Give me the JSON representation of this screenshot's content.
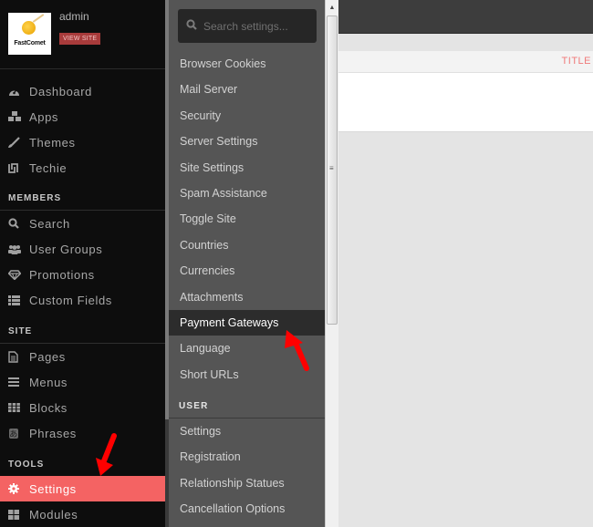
{
  "profile": {
    "logo_text": "FastComet",
    "username": "admin",
    "view_site_label": "VIEW SITE"
  },
  "sidebar": {
    "main_items": [
      {
        "label": "Dashboard",
        "icon": "dashboard-icon"
      },
      {
        "label": "Apps",
        "icon": "cubes-icon"
      },
      {
        "label": "Themes",
        "icon": "brush-icon"
      },
      {
        "label": "Techie",
        "icon": "techie-icon"
      }
    ],
    "sections": [
      {
        "title": "MEMBERS",
        "items": [
          {
            "label": "Search",
            "icon": "search-icon"
          },
          {
            "label": "User Groups",
            "icon": "users-icon"
          },
          {
            "label": "Promotions",
            "icon": "diamond-icon"
          },
          {
            "label": "Custom Fields",
            "icon": "list-icon"
          }
        ]
      },
      {
        "title": "SITE",
        "items": [
          {
            "label": "Pages",
            "icon": "file-icon"
          },
          {
            "label": "Menus",
            "icon": "menu-icon"
          },
          {
            "label": "Blocks",
            "icon": "grid-icon"
          },
          {
            "label": "Phrases",
            "icon": "phrases-icon"
          }
        ]
      },
      {
        "title": "TOOLS",
        "items": [
          {
            "label": "Settings",
            "icon": "gear-icon",
            "active": true
          },
          {
            "label": "Modules",
            "icon": "modules-icon"
          }
        ]
      }
    ]
  },
  "settings_panel": {
    "search_placeholder": "Search settings...",
    "items": [
      {
        "label": "Browser Cookies"
      },
      {
        "label": "Mail Server"
      },
      {
        "label": "Security"
      },
      {
        "label": "Server Settings"
      },
      {
        "label": "Site Settings"
      },
      {
        "label": "Spam Assistance"
      },
      {
        "label": "Toggle Site"
      },
      {
        "label": "Countries"
      },
      {
        "label": "Currencies"
      },
      {
        "label": "Attachments"
      },
      {
        "label": "Payment Gateways",
        "active": true
      },
      {
        "label": "Language"
      },
      {
        "label": "Short URLs"
      }
    ],
    "user_section": {
      "title": "USER",
      "items": [
        {
          "label": "Settings"
        },
        {
          "label": "Registration"
        },
        {
          "label": "Relationship Statues"
        },
        {
          "label": "Cancellation Options"
        }
      ]
    }
  },
  "main": {
    "table_header_title": "TITLE"
  },
  "colors": {
    "accent": "#f46363",
    "view_site_bg": "#a83b3b",
    "arrow": "#ff0000"
  }
}
